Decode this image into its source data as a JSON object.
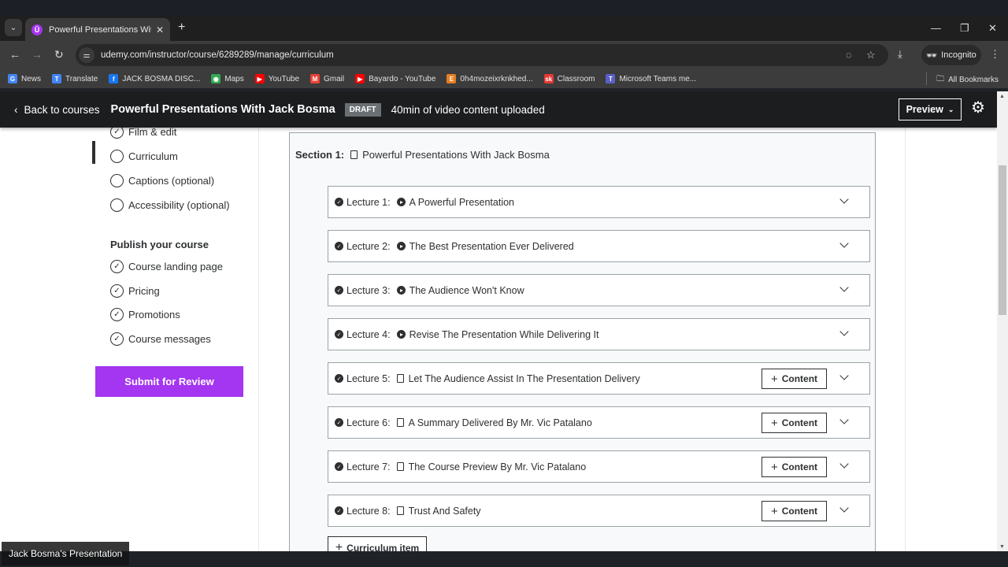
{
  "browser": {
    "tab_title": "Powerful Presentations With Jack Bosma",
    "url": "udemy.com/instructor/course/6289289/manage/curriculum",
    "incognito_label": "Incognito",
    "bookmarks": [
      {
        "label": "News",
        "color": "#4285f4",
        "glyph": "G"
      },
      {
        "label": "Translate",
        "color": "#4285f4",
        "glyph": "T"
      },
      {
        "label": "JACK BOSMA DISC...",
        "color": "#1877f2",
        "glyph": "f"
      },
      {
        "label": "Maps",
        "color": "#34a853",
        "glyph": "◉"
      },
      {
        "label": "YouTube",
        "color": "#ff0000",
        "glyph": "▶"
      },
      {
        "label": "Gmail",
        "color": "#ea4335",
        "glyph": "M"
      },
      {
        "label": "Bayardo - YouTube",
        "color": "#ff0000",
        "glyph": "▶"
      },
      {
        "label": "0h4mozeixrknkhed...",
        "color": "#e67e22",
        "glyph": "E"
      },
      {
        "label": "Classroom",
        "color": "#e53935",
        "glyph": "sk"
      },
      {
        "label": "Microsoft Teams me...",
        "color": "#5b5fc7",
        "glyph": "T"
      }
    ],
    "all_bookmarks_label": "All Bookmarks"
  },
  "header": {
    "back_label": "Back to courses",
    "course_title": "Powerful Presentations With Jack Bosma",
    "status_badge": "DRAFT",
    "upload_status": "40min of video content uploaded",
    "preview_label": "Preview"
  },
  "sidebar": {
    "plan_items": [
      {
        "label": "Film & edit",
        "checked": true
      },
      {
        "label": "Curriculum",
        "checked": false,
        "active": true
      },
      {
        "label": "Captions (optional)",
        "checked": false
      },
      {
        "label": "Accessibility (optional)",
        "checked": false
      }
    ],
    "publish_heading": "Publish your course",
    "publish_items": [
      {
        "label": "Course landing page",
        "checked": true
      },
      {
        "label": "Pricing",
        "checked": true
      },
      {
        "label": "Promotions",
        "checked": true
      },
      {
        "label": "Course messages",
        "checked": true
      }
    ],
    "submit_label": "Submit for Review"
  },
  "curriculum": {
    "section_label": "Section 1:",
    "section_title": "Powerful Presentations With Jack Bosma",
    "lectures": [
      {
        "label": "Lecture 1:",
        "title": "A Powerful Presentation",
        "type": "video",
        "has_content_button": false
      },
      {
        "label": "Lecture 2:",
        "title": "The Best Presentation Ever Delivered",
        "type": "video",
        "has_content_button": false
      },
      {
        "label": "Lecture 3:",
        "title": "The Audience Won't Know",
        "type": "video",
        "has_content_button": false
      },
      {
        "label": "Lecture 4:",
        "title": "Revise The Presentation While Delivering It",
        "type": "video",
        "has_content_button": false
      },
      {
        "label": "Lecture 5:",
        "title": "Let The Audience Assist In The Presentation Delivery",
        "type": "file",
        "has_content_button": true
      },
      {
        "label": "Lecture 6:",
        "title": "A Summary Delivered By Mr. Vic Patalano",
        "type": "file",
        "has_content_button": true
      },
      {
        "label": "Lecture 7:",
        "title": "The Course Preview By Mr. Vic Patalano",
        "type": "file",
        "has_content_button": true
      },
      {
        "label": "Lecture 8:",
        "title": "Trust And Safety",
        "type": "file",
        "has_content_button": true
      }
    ],
    "content_button_label": "Content",
    "add_item_label": "Curriculum item"
  },
  "overlay_caption": "Jack Bosma's Presentation",
  "colors": {
    "brand_purple": "#a435f0",
    "header_bg": "#1c1d1f",
    "text_dark": "#2d2f31"
  }
}
